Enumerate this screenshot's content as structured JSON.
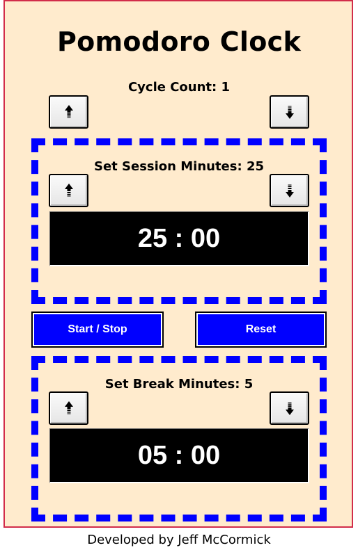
{
  "app": {
    "title": "Pomodoro Clock"
  },
  "cycle": {
    "label": "Cycle Count: 1"
  },
  "session": {
    "label": "Set Session Minutes: 25",
    "display": "25 : 00"
  },
  "controls": {
    "start_stop": "Start / Stop",
    "reset": "Reset"
  },
  "break": {
    "label": "Set Break Minutes: 5",
    "display": "05 : 00"
  },
  "footer": {
    "credit": "Developed by Jeff McCormick"
  },
  "icons": {
    "up": "arrow-up-icon",
    "down": "arrow-down-icon"
  },
  "colors": {
    "background": "#ffebcd",
    "frame_border": "#d22c4a",
    "accent": "#0000ff",
    "display_bg": "#000000"
  }
}
